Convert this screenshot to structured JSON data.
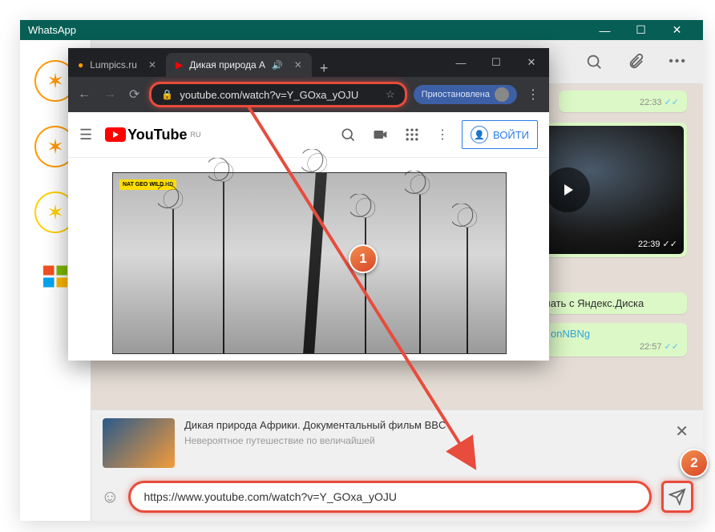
{
  "whatsapp": {
    "title": "WhatsApp",
    "messages": {
      "time1": "22:33",
      "video_time": "22:39",
      "text2": "качать с Яндекс.Диска",
      "text3": "onNBNg",
      "time3": "22:57"
    },
    "preview": {
      "title": "Дикая природа Африки. Документальный фильм BBC",
      "desc": "Невероятное путешествие по величайшей"
    },
    "input_value": "https://www.youtube.com/watch?v=Y_GOxa_yOJU"
  },
  "browser": {
    "tab1": "Lumpics.ru",
    "tab2": "Дикая природа А",
    "url": "youtube.com/watch?v=Y_GOxa_yOJU",
    "paused_chip": "Приостановлена"
  },
  "youtube": {
    "brand": "YouTube",
    "brand_sup": "RU",
    "login": "ВОЙТИ",
    "watermark": "NAT GEO WILD"
  },
  "steps": {
    "one": "1",
    "two": "2"
  }
}
